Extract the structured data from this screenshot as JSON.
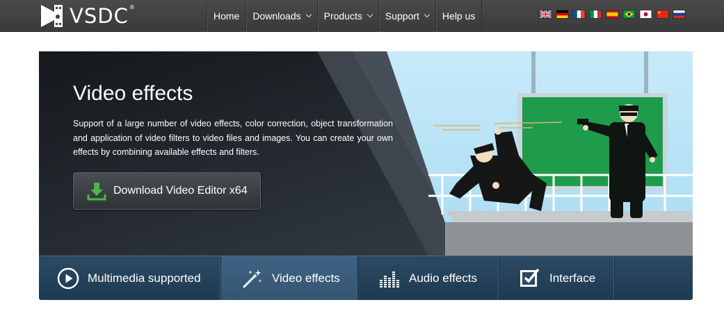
{
  "header": {
    "logo_text": "VSDC",
    "logo_reg": "®",
    "nav": [
      {
        "label": "Home",
        "has_dropdown": false
      },
      {
        "label": "Downloads",
        "has_dropdown": true
      },
      {
        "label": "Products",
        "has_dropdown": true
      },
      {
        "label": "Support",
        "has_dropdown": true
      },
      {
        "label": "Help us",
        "has_dropdown": false
      }
    ],
    "languages": [
      "english-flag",
      "german-flag",
      "french-flag",
      "italian-flag",
      "spanish-flag",
      "portuguese-brazil-flag",
      "japanese-flag",
      "chinese-flag",
      "russian-flag"
    ]
  },
  "banner": {
    "title": "Video effects",
    "description": "Support of a large number of video effects, color correction, object transformation and application of video filters to video files and images. You can create your own effects by combining available effects and filters.",
    "download_label": "Download Video Editor x64"
  },
  "tabs": [
    {
      "label": "Multimedia supported",
      "icon": "play-circle-icon",
      "active": false
    },
    {
      "label": "Video effects",
      "icon": "magic-wand-icon",
      "active": true
    },
    {
      "label": "Audio effects",
      "icon": "equalizer-icon",
      "active": false
    },
    {
      "label": "Interface",
      "icon": "edit-checkbox-icon",
      "active": false
    }
  ],
  "colors": {
    "topbar": "#404040",
    "banner_dark": "#1e2227",
    "sky": "#bfe6f6",
    "greenscreen": "#1f9b4c",
    "tabs": "#264562",
    "tab_active": "#3a5d7c",
    "download_arrow": "#4cb848"
  }
}
